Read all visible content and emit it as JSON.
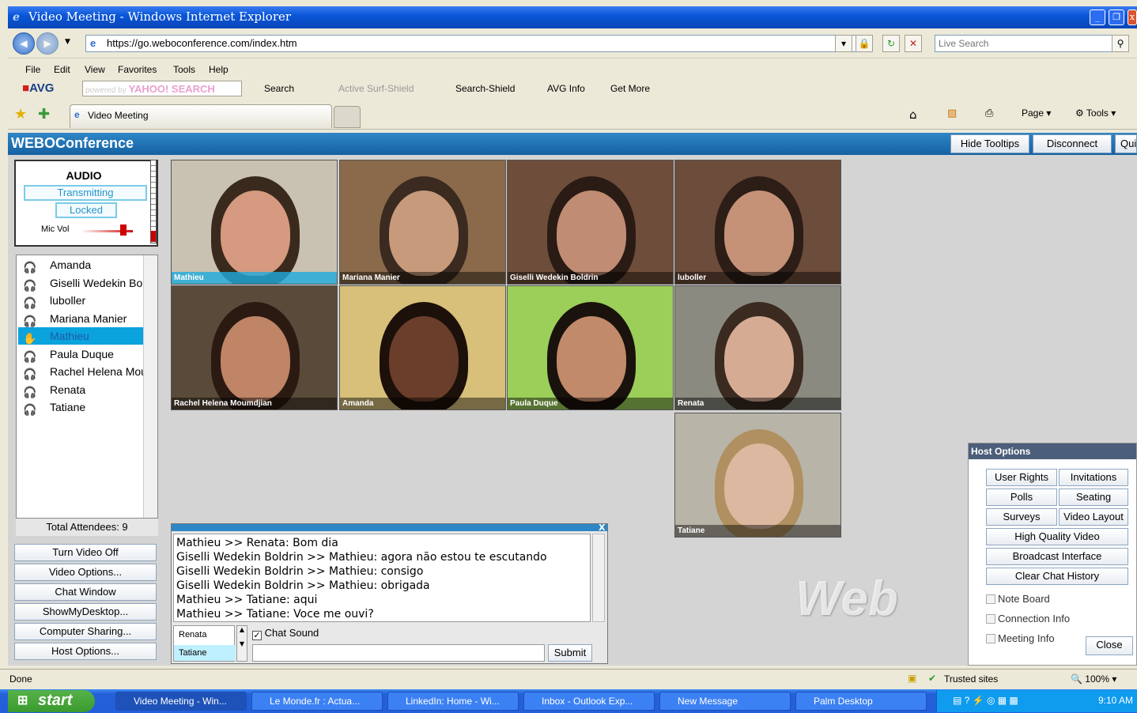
{
  "window": {
    "title": "Video Meeting - Windows Internet Explorer"
  },
  "browser": {
    "address": "https://go.weboconference.com/index.htm",
    "search_placeholder": "Live Search",
    "menu": [
      "File",
      "Edit",
      "View",
      "Favorites",
      "Tools",
      "Help"
    ],
    "avg": {
      "brand": "AVG",
      "powered": "powered by",
      "yahoo": "YAHOO! SEARCH",
      "search": "Search",
      "active_surf": "Active  Surf-Shield",
      "search_shield": "Search-Shield",
      "avg_info": "AVG Info",
      "get_more": "Get More"
    },
    "tab_title": "Video Meeting",
    "cmd": {
      "page": "Page",
      "tools": "Tools"
    }
  },
  "app": {
    "brand": "WEBOConference",
    "header_buttons": {
      "hide_tooltips": "Hide Tooltips",
      "disconnect": "Disconnect",
      "quit": "Qui"
    },
    "audio": {
      "title": "AUDIO",
      "transmitting": "Transmitting",
      "locked": "Locked",
      "mic_label": "Mic Vol",
      "mic_level": 0.82
    },
    "users": [
      {
        "name": "Amanda",
        "selected": false
      },
      {
        "name": "Giselli Wedekin Bo",
        "selected": false
      },
      {
        "name": "luboller",
        "selected": false
      },
      {
        "name": "Mariana Manier",
        "selected": false
      },
      {
        "name": "Mathieu",
        "selected": true
      },
      {
        "name": "Paula Duque",
        "selected": false
      },
      {
        "name": "Rachel Helena Mou",
        "selected": false
      },
      {
        "name": "Renata",
        "selected": false
      },
      {
        "name": "Tatiane",
        "selected": false
      }
    ],
    "total_attendees": "Total Attendees: 9",
    "left_buttons": [
      "Turn Video Off",
      "Video Options...",
      "Chat Window",
      "ShowMyDesktop...",
      "Computer Sharing...",
      "Host Options..."
    ],
    "videos": [
      {
        "name": "Mathieu",
        "active": true,
        "bg": "#c9c2b2",
        "skin": "#d59a80",
        "hair": "#3a2a1e"
      },
      {
        "name": "Mariana Manier",
        "active": false,
        "bg": "#8a6a4a",
        "skin": "#c79a7b",
        "hair": "#3b2a20"
      },
      {
        "name": "Giselli Wedekin Boldrin",
        "active": false,
        "bg": "#6e4e3a",
        "skin": "#c18c74",
        "hair": "#2a1c14"
      },
      {
        "name": "luboller",
        "active": false,
        "bg": "#6c4c3a",
        "skin": "#c59278",
        "hair": "#2c1e16"
      },
      {
        "name": "Rachel Helena Moumdjian",
        "active": false,
        "bg": "#5a4a3a",
        "skin": "#c08466",
        "hair": "#2a1a12"
      },
      {
        "name": "Amanda",
        "active": false,
        "bg": "#d8c07a",
        "skin": "#6a3e2a",
        "hair": "#1c100a"
      },
      {
        "name": "Paula Duque",
        "active": false,
        "bg": "#9ccf5a",
        "skin": "#c18a6a",
        "hair": "#1a120c"
      },
      {
        "name": "Renata",
        "active": false,
        "bg": "#8a8a80",
        "skin": "#d6ab94",
        "hair": "#3a2a20"
      },
      {
        "name": "Tatiane",
        "active": false,
        "bg": "#b8b4a8",
        "skin": "#dcb8a0",
        "hair": "#b09060"
      }
    ],
    "chat": {
      "messages": [
        "Mathieu >> Renata: Bom dia",
        "Giselli Wedekin Boldrin >> Mathieu: agora não estou te escutando",
        "Giselli Wedekin Boldrin >> Mathieu: consigo",
        "Giselli Wedekin Boldrin >> Mathieu: obrigada",
        "Mathieu >> Tatiane: aqui",
        "Mathieu >> Tatiane: Voce me ouvi?"
      ],
      "recipients": [
        "Renata",
        "Tatiane"
      ],
      "chat_sound": "Chat Sound",
      "submit": "Submit",
      "input_value": ""
    },
    "host_options": {
      "title": "Host Options",
      "user_rights": "User Rights",
      "invitations": "Invitations",
      "polls": "Polls",
      "seating": "Seating",
      "surveys": "Surveys",
      "video_layout": "Video Layout",
      "hq_video": "High Quality Video",
      "broadcast": "Broadcast Interface",
      "clear_chat": "Clear Chat History",
      "note_board": "Note Board",
      "connection_info": "Connection Info",
      "meeting_info": "Meeting Info",
      "close": "Close"
    },
    "watermark": "Web"
  },
  "statusbar": {
    "text": "Done",
    "zone": "Trusted sites",
    "zoom": "100%"
  },
  "taskbar": {
    "start": "start",
    "tasks": [
      "Video Meeting - Win...",
      "Le Monde.fr : Actua...",
      "LinkedIn: Home - Wi...",
      "Inbox - Outlook Exp...",
      "New Message",
      "Palm Desktop"
    ],
    "clock": "9:10 AM"
  }
}
